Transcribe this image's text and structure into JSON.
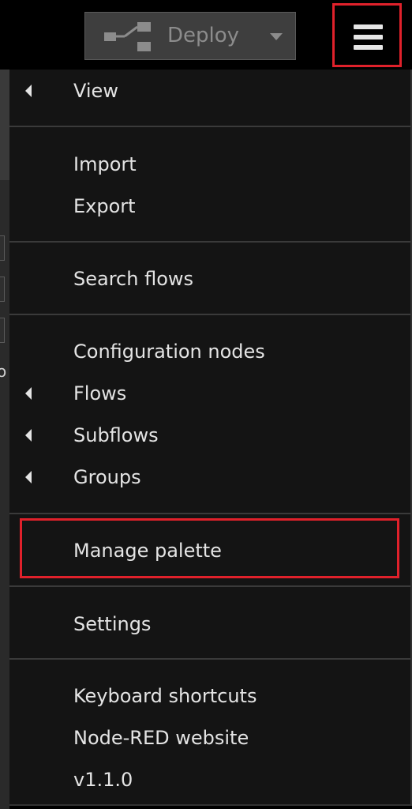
{
  "header": {
    "deploy_label": "Deploy",
    "deploy_icon": "deploy-icon",
    "menu_icon": "hamburger-icon"
  },
  "menu": {
    "view": "View",
    "import": "Import",
    "export": "Export",
    "search_flows": "Search flows",
    "configuration_nodes": "Configuration nodes",
    "flows": "Flows",
    "subflows": "Subflows",
    "groups": "Groups",
    "manage_palette": "Manage palette",
    "settings": "Settings",
    "keyboard_shortcuts": "Keyboard shortcuts",
    "nodered_website": "Node-RED website",
    "version": "v1.1.0"
  },
  "background": {
    "edge_text_1": "o",
    "edge_text_2": "l"
  },
  "colors": {
    "highlight": "#e0212b",
    "menu_background": "#141414",
    "menu_text": "#e4e4e4"
  }
}
